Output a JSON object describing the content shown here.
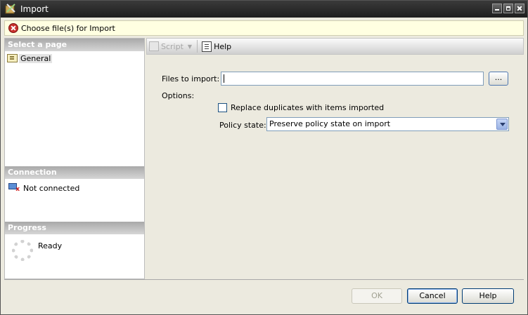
{
  "window": {
    "title": "Import",
    "icon": "import-icon",
    "controls": [
      "minimize",
      "maximize",
      "close"
    ]
  },
  "message_bar": {
    "icon": "error-icon",
    "text": "Choose file(s) for Import"
  },
  "left_panel": {
    "select_page": {
      "header": "Select a page",
      "items": [
        {
          "label": "General",
          "icon": "general-page-icon",
          "selected": true
        }
      ]
    },
    "connection": {
      "header": "Connection",
      "status": "Not connected",
      "icon": "computer-disconnected-icon"
    },
    "progress": {
      "header": "Progress",
      "status": "Ready",
      "icon": "progress-spinner-icon"
    }
  },
  "toolbar": {
    "script_label": "Script",
    "script_enabled": false,
    "help_label": "Help"
  },
  "form": {
    "files_label": "Files to import:",
    "files_value": "",
    "browse_label": "...",
    "options_label": "Options:",
    "replace_label": "Replace duplicates with items imported",
    "replace_checked": false,
    "policy_label": "Policy state:",
    "policy_value": "Preserve policy state on import"
  },
  "footer": {
    "ok_label": "OK",
    "ok_enabled": false,
    "cancel_label": "Cancel",
    "help_label": "Help"
  }
}
